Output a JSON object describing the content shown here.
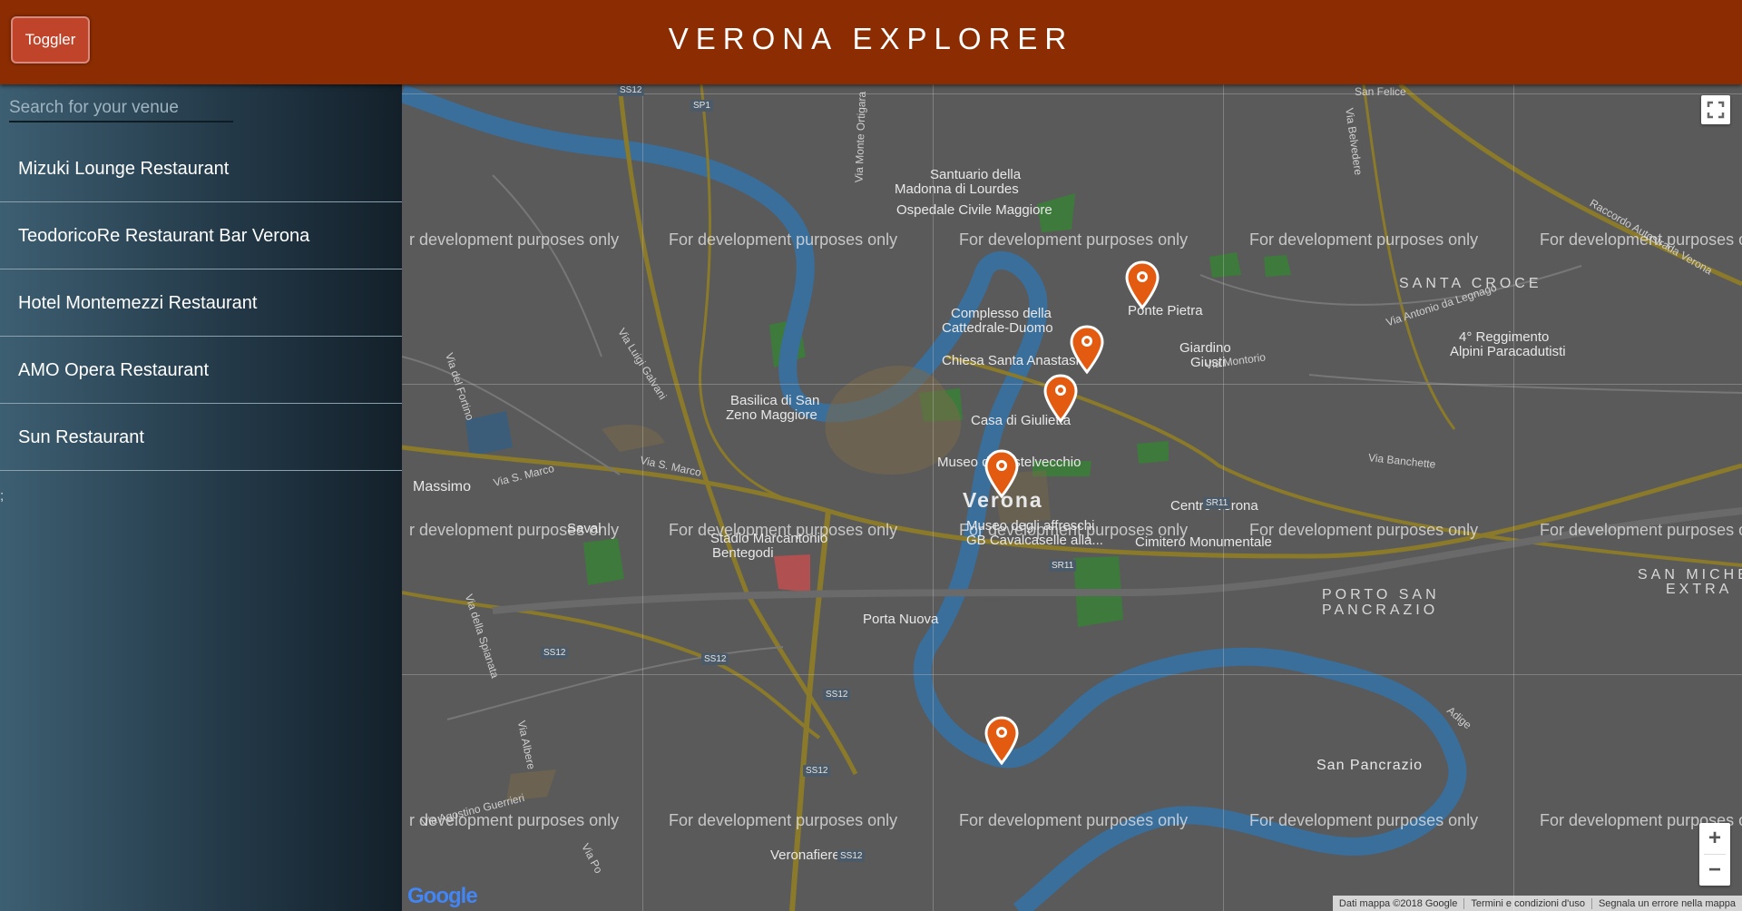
{
  "header": {
    "title": "VERONA EXPLORER",
    "toggler_label": "Toggler"
  },
  "sidebar": {
    "search_placeholder": "Search for your venue",
    "venues": [
      "Mizuki Lounge Restaurant",
      "TeodoricoRe Restaurant Bar Verona",
      "Hotel Montemezzi Restaurant",
      "AMO Opera Restaurant",
      "Sun Restaurant"
    ],
    "stray_text": ";"
  },
  "map": {
    "dev_watermark": "For development purposes only",
    "dev_watermark_cut": "r development purposes only",
    "labels": {
      "city": "Verona",
      "santa_croce": "SANTA CROCE",
      "porto_1": "PORTO SAN",
      "porto_2": "PANCRAZIO",
      "san_michele_1": "SAN MICHE",
      "san_michele_2": "EXTRA",
      "san_pancrazio": "San Pancrazio",
      "san_felice": "San Felice",
      "santuario_1": "Santuario della",
      "santuario_2": "Madonna di Lourdes",
      "ospedale": "Ospedale Civile Maggiore",
      "complesso_1": "Complesso della",
      "complesso_2": "Cattedrale-Duomo",
      "chiesa": "Chiesa Santa Anastasia",
      "ponte_pietra": "Ponte Pietra",
      "giardino_1": "Giardino",
      "giardino_2": "Giusti",
      "basilica_1": "Basilica di San",
      "basilica_2": "Zeno Maggiore",
      "casa_giulietta": "Casa di Giulietta",
      "museo_castelvecchio": "Museo di Castelvecchio",
      "centro_verona": "Centro Verona",
      "cimitero": "Cimitero Monumentale",
      "museo_affreschi_1": "Museo degli affreschi",
      "museo_affreschi_2": "GB Cavalcaselle alla...",
      "stadio_1": "Stadio Marcantonio",
      "stadio_2": "Bentegodi",
      "porta_nuova": "Porta Nuova",
      "veronafiere": "Veronafiere",
      "reggimento_1": "4° Reggimento",
      "reggimento_2": "Alpini Paracadutisti",
      "massimo": "Massimo",
      "saval": "Saval"
    },
    "streets": {
      "via_s_marco": "Via S. Marco",
      "via_s_marco_2": "Via S. Marco",
      "via_montorio": "Via Montorio",
      "via_banchette": "Via Banchette",
      "via_del_fortino": "Via del Fortino",
      "via_della_spianata": "Via della Spianata",
      "via_albere": "Via Albere",
      "via_luigi_galvani": "Via Luigi Galvani",
      "via_antonio_lenghe": "Via Antonio da Legnago",
      "raccordo": "Raccordo Autostrada Verona",
      "via_belvedere": "Via Belvedere",
      "via_monte_ortigara": "Via Monte Ortigara",
      "via_po": "Via Po",
      "via_agostino": "Via Agostino Guerrieri",
      "adige": "Adige"
    },
    "road_badges": [
      "SS12",
      "SP1",
      "SS12",
      "SS12",
      "SS12",
      "SS12",
      "SS12",
      "SR11",
      "SR11"
    ],
    "logo": "Google",
    "attribution": [
      "Dati mappa ©2018 Google",
      "Termini e condizioni d'uso",
      "Segnala un errore nella mappa"
    ],
    "zoom_in": "+",
    "zoom_out": "−",
    "marker_color": "#e35b10"
  }
}
